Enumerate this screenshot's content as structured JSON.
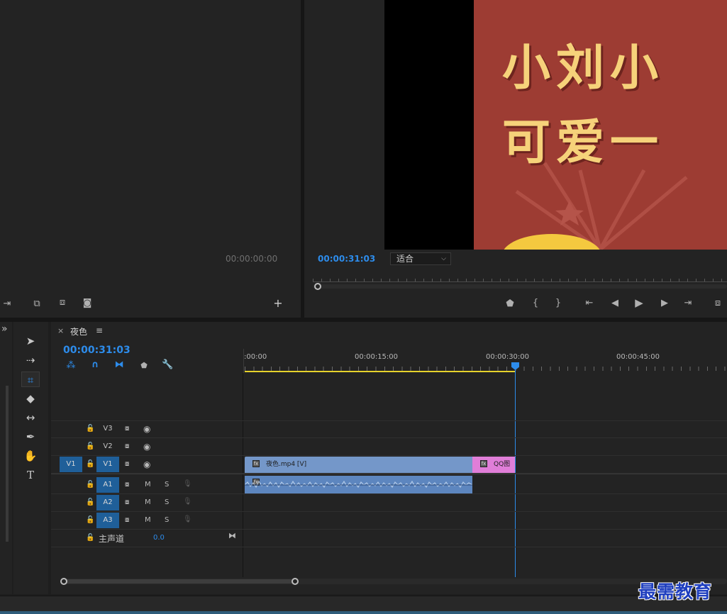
{
  "source_monitor": {
    "timecode": "00:00:00:00"
  },
  "program_monitor": {
    "timecode": "00:00:31:03",
    "zoom_select": {
      "selected": "适合"
    },
    "preview_text_line1": "小刘小",
    "preview_text_line2": "可爱一"
  },
  "timeline": {
    "tab_title": "夜色",
    "close_glyph": "×",
    "menu_glyph": "≡",
    "timecode": "00:00:31:03",
    "ruler_labels": [
      ":00:00",
      "00:00:15:00",
      "00:00:30:00",
      "00:00:45:00"
    ],
    "tracks": {
      "v3": "V3",
      "v2": "V2",
      "v1": "V1",
      "v1_source": "V1",
      "a1": "A1",
      "a2": "A2",
      "a3": "A3",
      "master": "主声道",
      "master_value": "0.0",
      "mute": "M",
      "solo": "S"
    },
    "clips": {
      "video1": "夜色.mp4 [V]",
      "video2": "QQ图"
    }
  },
  "panel_chevron": "»",
  "watermark": "最需教育",
  "colors": {
    "accent_blue": "#2d8ceb",
    "video_clip": "#7497c9",
    "pink_clip": "#e07ed8",
    "audio_clip": "#5d86bf",
    "preview_bg": "#9d3c33",
    "preview_text": "#f6d27a"
  }
}
